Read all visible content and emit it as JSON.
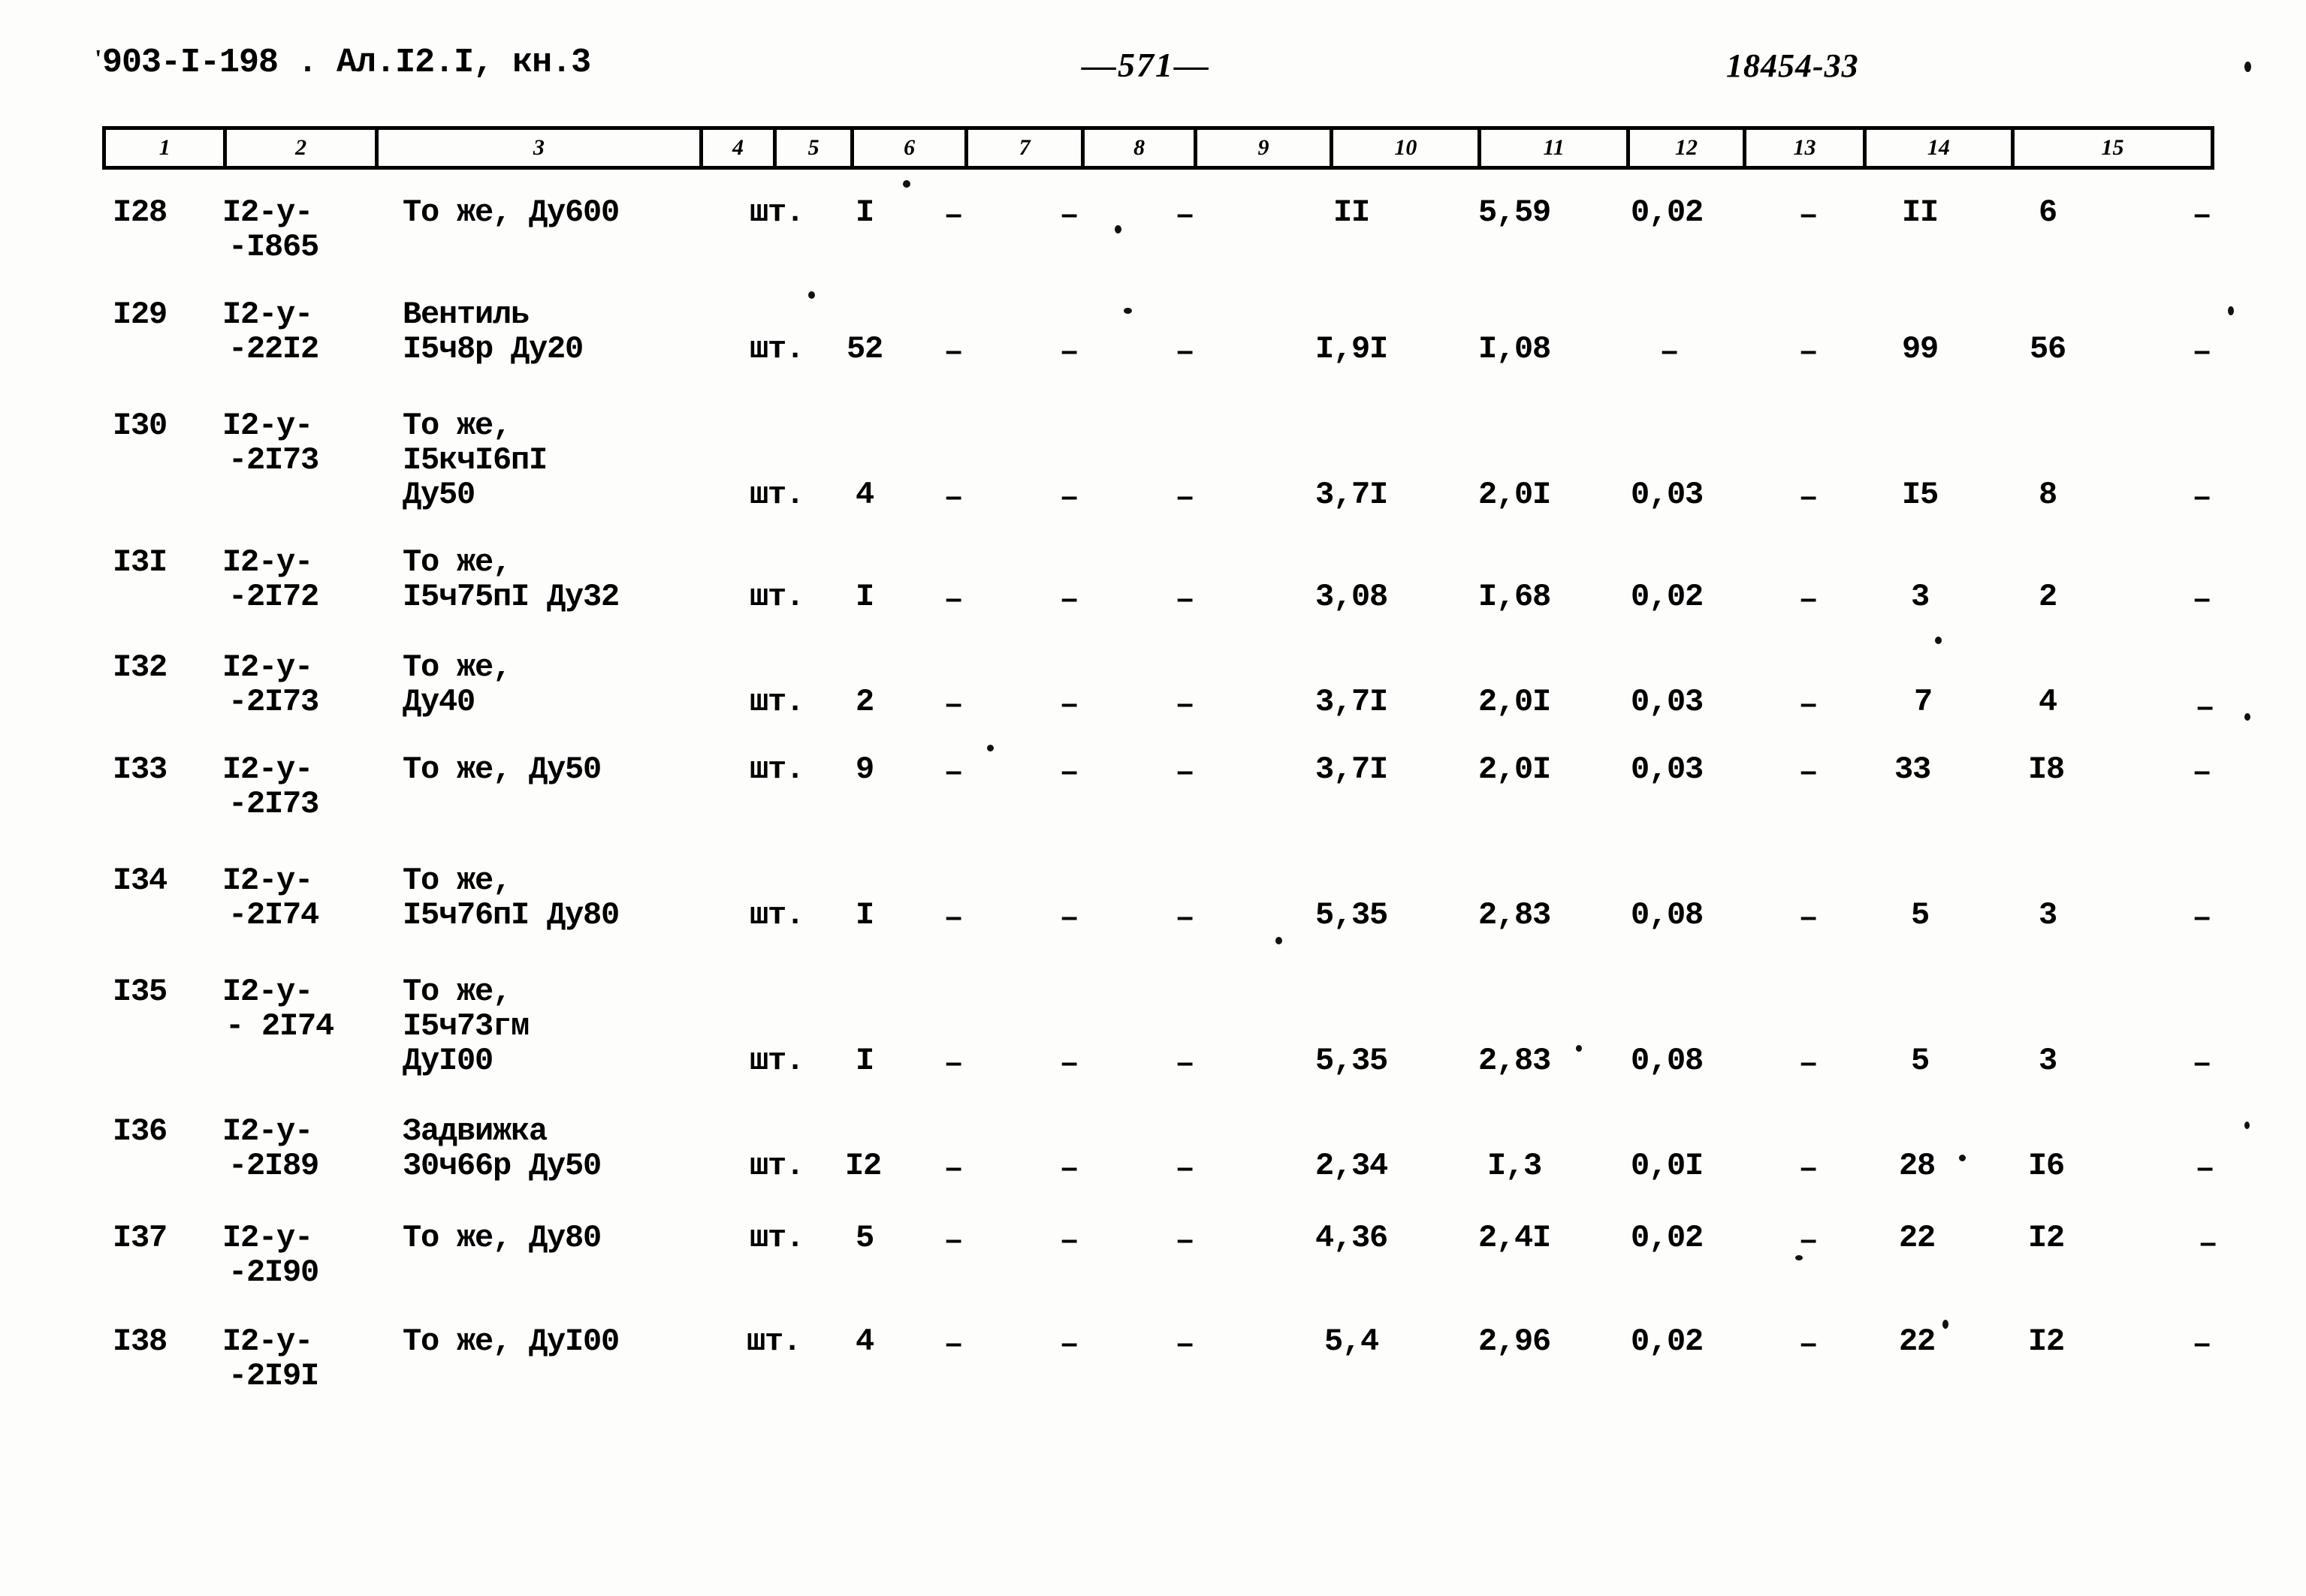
{
  "header": {
    "left_code": "903-I-198 . Ал.I2.I, кн.3",
    "left_tick": "'",
    "page_number": "—571—",
    "right_code": "18454-33"
  },
  "table": {
    "column_headers": [
      "1",
      "2",
      "3",
      "4",
      "5",
      "6",
      "7",
      "8",
      "9",
      "10",
      "11",
      "12",
      "13",
      "14",
      "15"
    ],
    "rows": [
      {
        "pos": "I28",
        "code_line1": "I2-у-",
        "code_line2": "-I865",
        "name_lines": [
          "То же, Ду600"
        ],
        "unit": "шт.",
        "qty": "I",
        "c6": "–",
        "c7": "–",
        "c8": "–",
        "c9": "II",
        "c10": "5,59",
        "c11": "0,02",
        "c12": "–",
        "c13": "II",
        "c14": "6",
        "c15": "–"
      },
      {
        "pos": "I29",
        "code_line1": "I2-у-",
        "code_line2": "-22I2",
        "name_lines": [
          "Вентиль",
          "I5ч8р Ду20"
        ],
        "unit": "шт.",
        "qty": "52",
        "c6": "–",
        "c7": "–",
        "c8": "–",
        "c9": "I,9I",
        "c10": "I,08",
        "c11": "–",
        "c12": "–",
        "c13": "99",
        "c14": "56",
        "c15": "–"
      },
      {
        "pos": "I30",
        "code_line1": "I2-у-",
        "code_line2": "-2I73",
        "name_lines": [
          "То же,",
          "I5кчI6пI",
          "Ду50"
        ],
        "unit": "шт.",
        "qty": "4",
        "c6": "–",
        "c7": "–",
        "c8": "–",
        "c9": "3,7I",
        "c10": "2,0I",
        "c11": "0,03",
        "c12": "–",
        "c13": "I5",
        "c14": "8",
        "c15": "–"
      },
      {
        "pos": "I3I",
        "code_line1": "I2-у-",
        "code_line2": "-2I72",
        "name_lines": [
          "То же,",
          "I5ч75пI Ду32"
        ],
        "unit": "шт.",
        "qty": "I",
        "c6": "–",
        "c7": "–",
        "c8": "–",
        "c9": "3,08",
        "c10": "I,68",
        "c11": "0,02",
        "c12": "–",
        "c13": "3",
        "c14": "2",
        "c15": "–"
      },
      {
        "pos": "I32",
        "code_line1": "I2-у-",
        "code_line2": "-2I73",
        "name_lines": [
          "То же,",
          "Ду40"
        ],
        "unit": "шт.",
        "qty": "2",
        "c6": "–",
        "c7": "–",
        "c8": "–",
        "c9": "3,7I",
        "c10": "2,0I",
        "c11": "0,03",
        "c12": "–",
        "c13": "7",
        "c14": "4",
        "c15": "–"
      },
      {
        "pos": "I33",
        "code_line1": "I2-у-",
        "code_line2": "-2I73",
        "name_lines": [
          "То же, Ду50"
        ],
        "unit": "шт.",
        "qty": "9",
        "c6": "–",
        "c7": "–",
        "c8": "–",
        "c9": "3,7I",
        "c10": "2,0I",
        "c11": "0,03",
        "c12": "–",
        "c13": "33",
        "c14": "I8",
        "c15": "–"
      },
      {
        "pos": "I34",
        "code_line1": "I2-у-",
        "code_line2": "-2I74",
        "name_lines": [
          "То же,",
          "I5ч76пI Ду80"
        ],
        "unit": "шт.",
        "qty": "I",
        "c6": "–",
        "c7": "–",
        "c8": "–",
        "c9": "5,35",
        "c10": "2,83",
        "c11": "0,08",
        "c12": "–",
        "c13": "5",
        "c14": "3",
        "c15": "–"
      },
      {
        "pos": "I35",
        "code_line1": "I2-у-",
        "code_line2": "- 2I74",
        "name_lines": [
          "То же,",
          "I5ч73гм",
          "ДуI00"
        ],
        "unit": "шт.",
        "qty": "I",
        "c6": "–",
        "c7": "–",
        "c8": "–",
        "c9": "5,35",
        "c10": "2,83",
        "c11": "0,08",
        "c12": "–",
        "c13": "5",
        "c14": "3",
        "c15": "–"
      },
      {
        "pos": "I36",
        "code_line1": "I2-у-",
        "code_line2": "-2I89",
        "name_lines": [
          "Задвижка",
          "30ч66р Ду50"
        ],
        "unit": "шт.",
        "qty": "I2",
        "c6": "–",
        "c7": "–",
        "c8": "–",
        "c9": "2,34",
        "c10": "I,3",
        "c11": "0,0I",
        "c12": "–",
        "c13": "28",
        "c14": "I6",
        "c15": "–"
      },
      {
        "pos": "I37",
        "code_line1": "I2-у-",
        "code_line2": "-2I90",
        "name_lines": [
          "То же, Ду80"
        ],
        "unit": "шт.",
        "qty": "5",
        "c6": "–",
        "c7": "–",
        "c8": "–",
        "c9": "4,36",
        "c10": "2,4I",
        "c11": "0,02",
        "c12": "–",
        "c13": "22",
        "c14": "I2",
        "c15": "–"
      },
      {
        "pos": "I38",
        "code_line1": "I2-у-",
        "code_line2": "-2I9I",
        "name_lines": [
          "То же, ДуI00"
        ],
        "unit": "шт.",
        "qty": "4",
        "c6": "–",
        "c7": "–",
        "c8": "–",
        "c9": "5,4",
        "c10": "2,96",
        "c11": "0,02",
        "c12": "–",
        "c13": "22",
        "c14": "I2",
        "c15": "–"
      }
    ]
  }
}
